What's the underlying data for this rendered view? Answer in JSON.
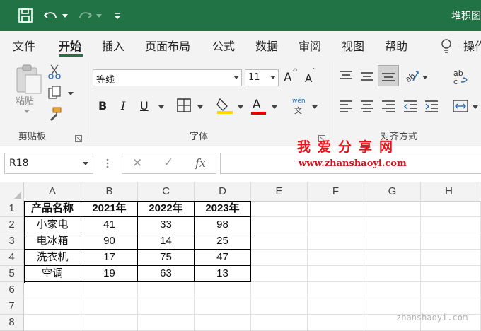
{
  "window": {
    "title": "堆积图"
  },
  "quick_access": {
    "save_icon": "save-icon",
    "undo_icon": "undo-icon",
    "redo_icon": "redo-icon",
    "customize_icon": "customize-icon"
  },
  "tabs": [
    "文件",
    "开始",
    "插入",
    "页面布局",
    "公式",
    "数据",
    "审阅",
    "视图",
    "帮助",
    "操作"
  ],
  "active_tab": "开始",
  "ribbon": {
    "clipboard": {
      "paste_label": "粘贴",
      "group_label": "剪贴板"
    },
    "font": {
      "font_name": "等线",
      "font_size": "11",
      "bold": "B",
      "italic": "I",
      "underline": "U",
      "font_color_letter": "A",
      "phonetic_top": "wén",
      "phonetic_bottom": "文",
      "group_label": "字体",
      "grow": "A",
      "shrink": "A"
    },
    "alignment": {
      "group_label": "对齐方式"
    },
    "accent_color": "#217346",
    "font_color": "#e00000",
    "highlight_color": "#ffd700"
  },
  "formula_bar": {
    "name_box": "R18",
    "cancel": "✕",
    "enter": "✓",
    "fx": "fx",
    "value": ""
  },
  "watermark": {
    "title": "我爱分享网",
    "url": "www.zhanshaoyi.com",
    "bottom": "zhanshaoyi.com"
  },
  "sheet": {
    "columns": [
      "A",
      "B",
      "C",
      "D",
      "E",
      "F",
      "G",
      "H"
    ],
    "rows": [
      "1",
      "2",
      "3",
      "4",
      "5",
      "6",
      "7",
      "8"
    ],
    "table": [
      [
        "产品名称",
        "2021年",
        "2022年",
        "2023年"
      ],
      [
        "小家电",
        "41",
        "33",
        "98"
      ],
      [
        "电冰箱",
        "90",
        "14",
        "25"
      ],
      [
        "洗衣机",
        "17",
        "75",
        "47"
      ],
      [
        "空调",
        "19",
        "63",
        "13"
      ]
    ]
  }
}
